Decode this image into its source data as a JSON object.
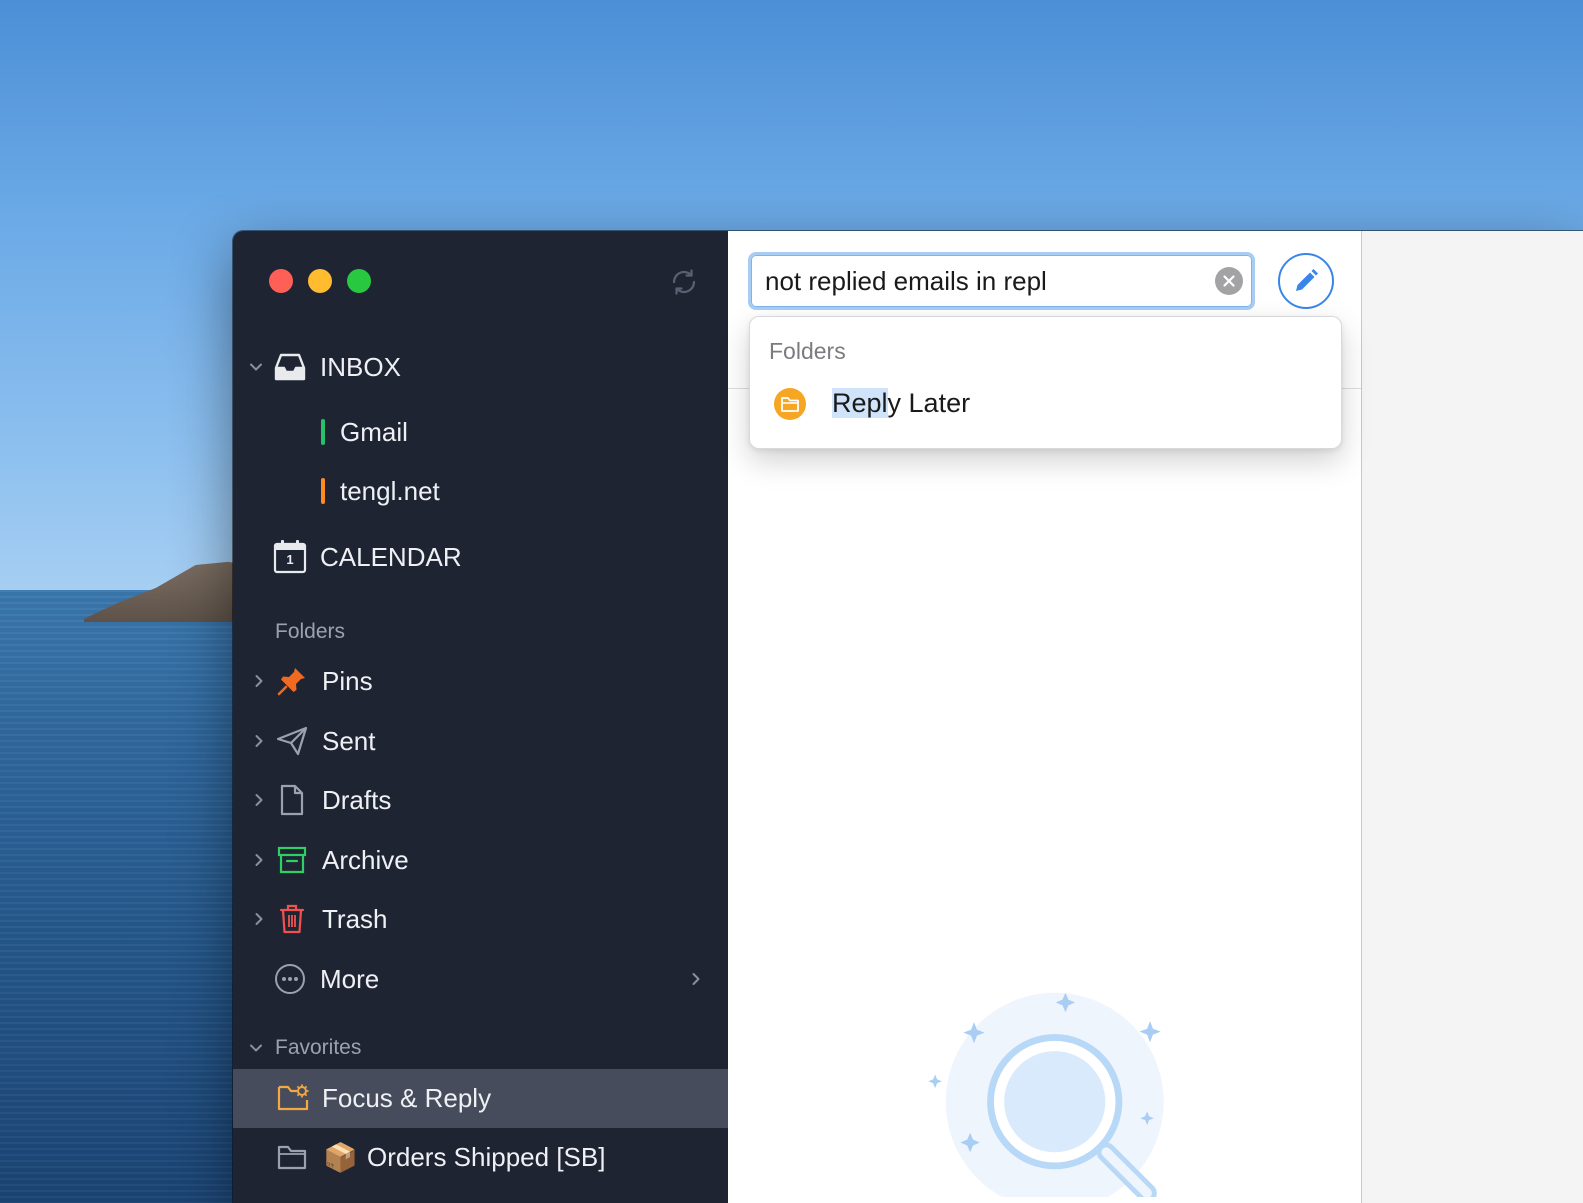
{
  "sidebar": {
    "inbox": {
      "label": "INBOX",
      "icon": "tray-icon"
    },
    "accounts": [
      {
        "label": "Gmail",
        "color": "#27c06b"
      },
      {
        "label": "tengl.net",
        "color": "#ff8a1f"
      }
    ],
    "calendar": {
      "label": "CALENDAR",
      "day": "1",
      "icon": "calendar-icon"
    },
    "folders_heading": "Folders",
    "folders": [
      {
        "label": "Pins",
        "icon": "pin-icon",
        "color": "#f06a22"
      },
      {
        "label": "Sent",
        "icon": "paper-plane-icon",
        "color": "#9aa1b0"
      },
      {
        "label": "Drafts",
        "icon": "document-icon",
        "color": "#9aa1b0"
      },
      {
        "label": "Archive",
        "icon": "archive-box-icon",
        "color": "#2fcf63"
      },
      {
        "label": "Trash",
        "icon": "trash-icon",
        "color": "#ef5350"
      },
      {
        "label": "More",
        "icon": "ellipsis-circle-icon",
        "color": "#9aa1b0"
      }
    ],
    "favorites_heading": "Favorites",
    "favorites": [
      {
        "label": "Focus & Reply",
        "icon": "smart-folder-icon",
        "color": "#f5a742",
        "selected": true
      },
      {
        "label": "Orders Shipped [SB]",
        "icon": "package-emoji",
        "emoji": "📦",
        "selected": false
      }
    ]
  },
  "search": {
    "value": "not replied emails in repl",
    "clear_icon": "clear-icon"
  },
  "compose": {
    "icon": "pencil-icon",
    "color": "#3a86e8"
  },
  "suggestions": {
    "section": "Folders",
    "items": [
      {
        "highlight": "Repl",
        "rest": "y Later",
        "icon": "folder-icon",
        "color": "#f5a623"
      }
    ]
  }
}
